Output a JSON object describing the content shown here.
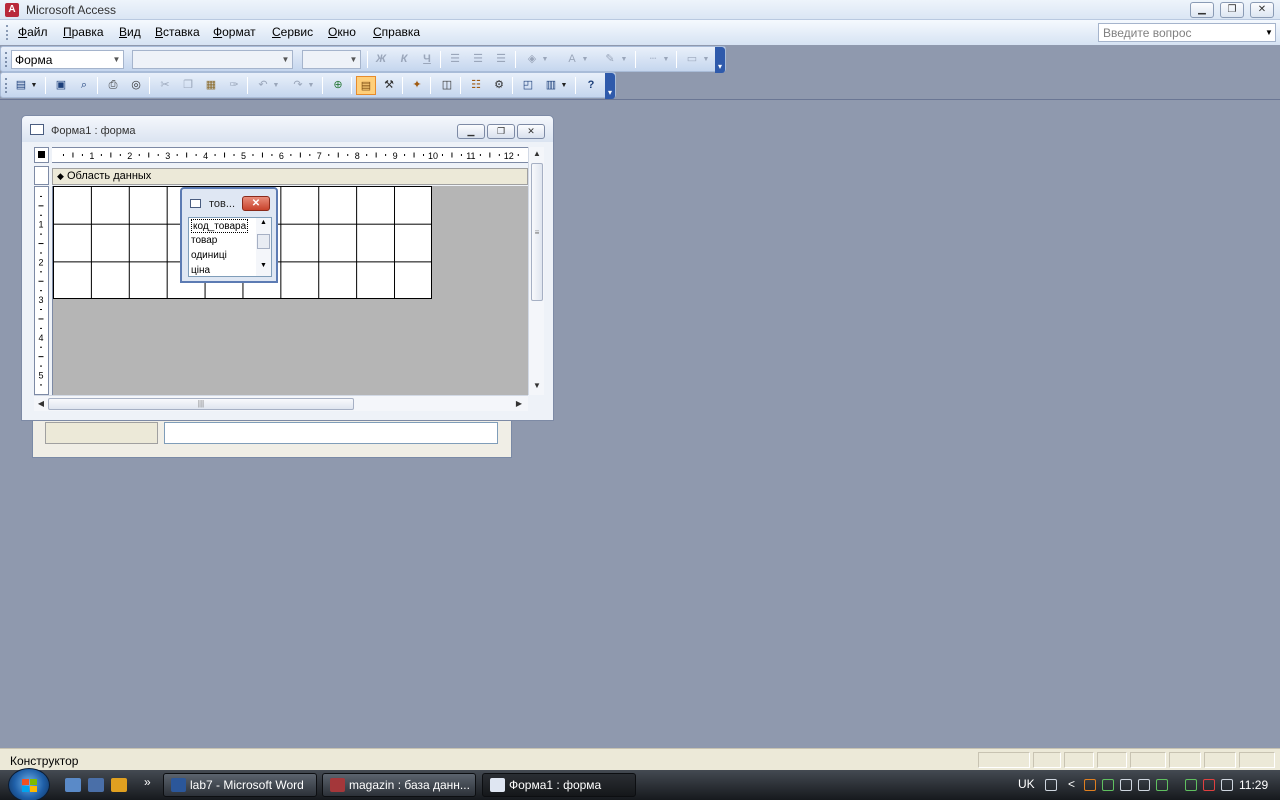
{
  "app": {
    "title": "Microsoft Access",
    "window_controls": {
      "minimize": "▁",
      "restore": "❐",
      "close": "✕"
    }
  },
  "menu": {
    "items": [
      {
        "label": "Файл"
      },
      {
        "label": "Правка"
      },
      {
        "label": "Вид"
      },
      {
        "label": "Вставка"
      },
      {
        "label": "Формат"
      },
      {
        "label": "Сервис"
      },
      {
        "label": "Окно"
      },
      {
        "label": "Справка"
      }
    ],
    "ask_placeholder": "Введите вопрос"
  },
  "format_toolbar": {
    "object_combo": "Форма",
    "font_combo": "",
    "size_combo": "",
    "bold": "Ж",
    "italic": "К",
    "underline": "Ч",
    "font_color_glyph": "A"
  },
  "form_window": {
    "title": "Форма1 : форма",
    "section_label": "Область данных",
    "ruler_h": [
      "1",
      "2",
      "3",
      "4",
      "5",
      "6",
      "7",
      "8",
      "9",
      "10",
      "11",
      "12"
    ],
    "ruler_v": [
      "1",
      "2",
      "3",
      "4",
      "5"
    ]
  },
  "field_list": {
    "title": "тов...",
    "fields": [
      "код_товара",
      "товар",
      "одиниці",
      "ціна"
    ],
    "selected_index": 0
  },
  "statusbar": {
    "mode": "Конструктор"
  },
  "taskbar": {
    "tasks": [
      {
        "label": "lab7 - Microsoft Word",
        "icon": "word-icon",
        "active": false
      },
      {
        "label": "magazin : база данн...",
        "icon": "access-db-icon",
        "active": false
      },
      {
        "label": "Форма1 : форма",
        "icon": "form-icon",
        "active": true
      }
    ],
    "tray": {
      "language": "UK",
      "clock": "11:29",
      "overflow_glyph": "»",
      "expand_glyph": "<"
    }
  },
  "colors": {
    "workspace": "#8f99ae",
    "accent": "#2f5aab",
    "active_button": "#ffcf7a"
  }
}
